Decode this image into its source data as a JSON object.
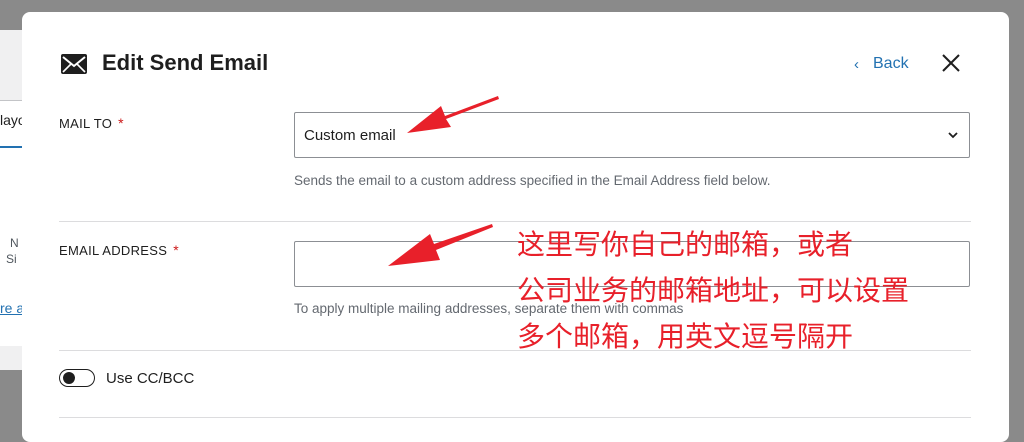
{
  "background": {
    "fragments": [
      "layo",
      "N",
      "Si",
      "re a"
    ]
  },
  "modal": {
    "title": "Edit Send Email",
    "icon": "envelope-icon",
    "back_label": "Back",
    "close_icon": "close-icon"
  },
  "form": {
    "mail_to": {
      "label": "MAIL TO",
      "required_mark": "*",
      "selected_value": "Custom email",
      "help_text": "Sends the email to a custom address specified in the Email Address field below."
    },
    "email_address": {
      "label": "EMAIL ADDRESS",
      "required_mark": "*",
      "value": "",
      "help_text": "To apply multiple mailing addresses, separate them with commas"
    },
    "cc_bcc": {
      "label": "Use CC/BCC",
      "enabled": false
    }
  },
  "annotation": {
    "lines": [
      "这里写你自己的邮箱，或者",
      "公司业务的邮箱地址，可以设置",
      "多个邮箱，用英文逗号隔开"
    ]
  },
  "colors": {
    "accent": "#2271b1",
    "required": "#cc1818",
    "annotation": "#e8202a"
  }
}
